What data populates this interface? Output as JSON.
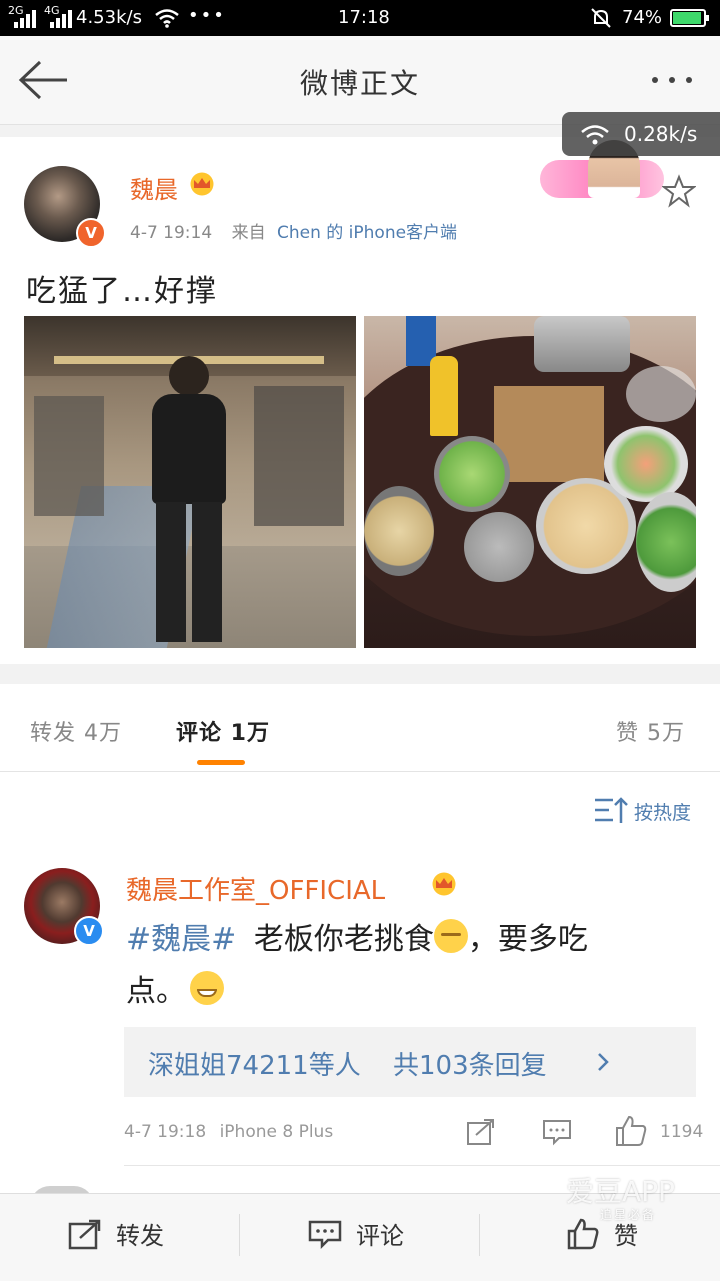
{
  "status_bar": {
    "network_1": "2G",
    "network_2": "4G",
    "speed": "4.53k/s",
    "more": "•••",
    "time": "17:18",
    "battery": "74%"
  },
  "nav": {
    "title": "微博正文"
  },
  "net_overlay": {
    "speed": "0.28k/s"
  },
  "post": {
    "author": "魏晨",
    "time": "4-7 19:14",
    "from_label": "来自",
    "source": "Chen 的 iPhone客户端",
    "text": "吃猛了…好撑",
    "images": [
      "gym-mirror-selfie",
      "food-containers-on-table"
    ]
  },
  "tabs": {
    "repost": "转发 4万",
    "comments": "评论 1万",
    "likes": "赞 5万"
  },
  "sort": {
    "label": "按热度"
  },
  "comment": {
    "author": "魏晨工作室_OFFICIAL",
    "hashtag": "#魏晨#",
    "text_line1": "老板你老挑食",
    "text_line1b": "，要多吃",
    "text_line2": "点。",
    "replies_users": "深姐姐74211等人",
    "replies_count": "共103条回复",
    "time": "4-7 19:18",
    "device": "iPhone 8 Plus",
    "like_count": "1194"
  },
  "bottom_bar": {
    "repost": "转发",
    "comment": "评论",
    "like": "赞"
  },
  "watermark": {
    "brand": "爱豆APP",
    "sub": "追星必备"
  },
  "colors": {
    "orange_name": "#e8682a",
    "link_blue": "#507daf",
    "tab_indicator": "#ff8200",
    "vip_red": "#f0642c",
    "verified_blue": "#2a8cf0"
  }
}
